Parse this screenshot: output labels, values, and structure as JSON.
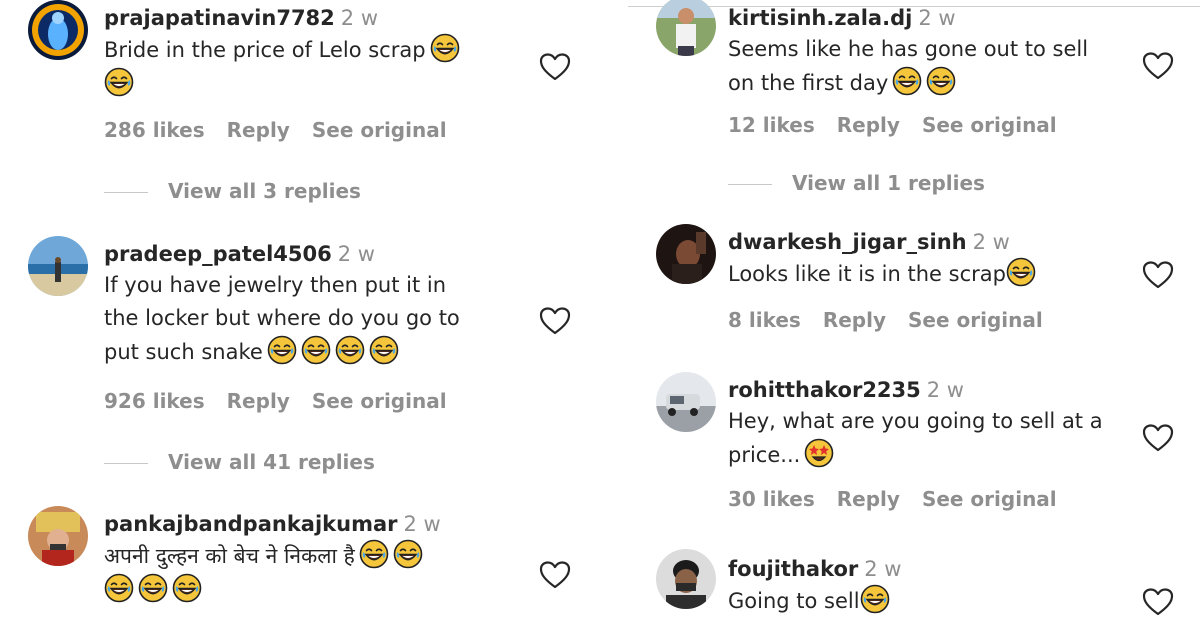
{
  "comments_left": [
    {
      "username": "prajapatinavin7782",
      "age": "2 w",
      "text_lines": [
        "Bride in the price of Lelo scrap",
        ""
      ],
      "emojis_line": [
        [
          "laugh"
        ],
        [
          "laugh"
        ]
      ],
      "likes": "286 likes",
      "reply": "Reply",
      "see_original": "See original",
      "view_replies": "View all 3 replies"
    },
    {
      "username": "pradeep_patel4506",
      "age": "2 w",
      "text_lines": [
        "If you have jewelry then put it in",
        "the locker but where do you go to",
        "put such snake"
      ],
      "emojis_line": [
        [],
        [],
        [
          "laugh",
          "laugh",
          "laugh",
          "laugh"
        ]
      ],
      "likes": "926 likes",
      "reply": "Reply",
      "see_original": "See original",
      "view_replies": "View all 41 replies"
    },
    {
      "username": "pankajbandpankajkumar",
      "age": "2 w",
      "text_lines": [
        "अपनी दुल्हन को बेच ने निकला है",
        ""
      ],
      "emojis_line": [
        [
          "laugh",
          "laugh"
        ],
        [
          "laugh",
          "laugh",
          "laugh"
        ]
      ]
    }
  ],
  "comments_right": [
    {
      "username": "kirtisinh.zala.dj",
      "age": "2 w",
      "text_lines": [
        "Seems like he has gone out to sell",
        "on the first day"
      ],
      "emojis_line": [
        [],
        [
          "laugh",
          "laugh"
        ]
      ],
      "likes": "12 likes",
      "reply": "Reply",
      "see_original": "See original",
      "view_replies": "View all 1 replies"
    },
    {
      "username": "dwarkesh_jigar_sinh",
      "age": "2 w",
      "text_lines": [
        "Looks like it is in the scrap"
      ],
      "emojis_line": [
        [
          "laugh"
        ]
      ],
      "likes": "8 likes",
      "reply": "Reply",
      "see_original": "See original"
    },
    {
      "username": "rohitthakor2235",
      "age": "2 w",
      "text_lines": [
        "Hey, what are you going to sell at a",
        "price..."
      ],
      "emojis_line": [
        [],
        [
          "starstruck"
        ]
      ],
      "likes": "30 likes",
      "reply": "Reply",
      "see_original": "See original"
    },
    {
      "username": "foujithakor",
      "age": "2 w",
      "text_lines": [
        "Going to sell"
      ],
      "emojis_line": [
        [
          "laugh"
        ]
      ]
    }
  ],
  "icons": {
    "heart": "heart-outline-icon",
    "laugh": "face-with-tears-of-joy-emoji",
    "starstruck": "star-struck-emoji"
  },
  "colors": {
    "text": "#262626",
    "muted": "#8e8e8e",
    "emoji_yellow": "#f5c63b"
  }
}
